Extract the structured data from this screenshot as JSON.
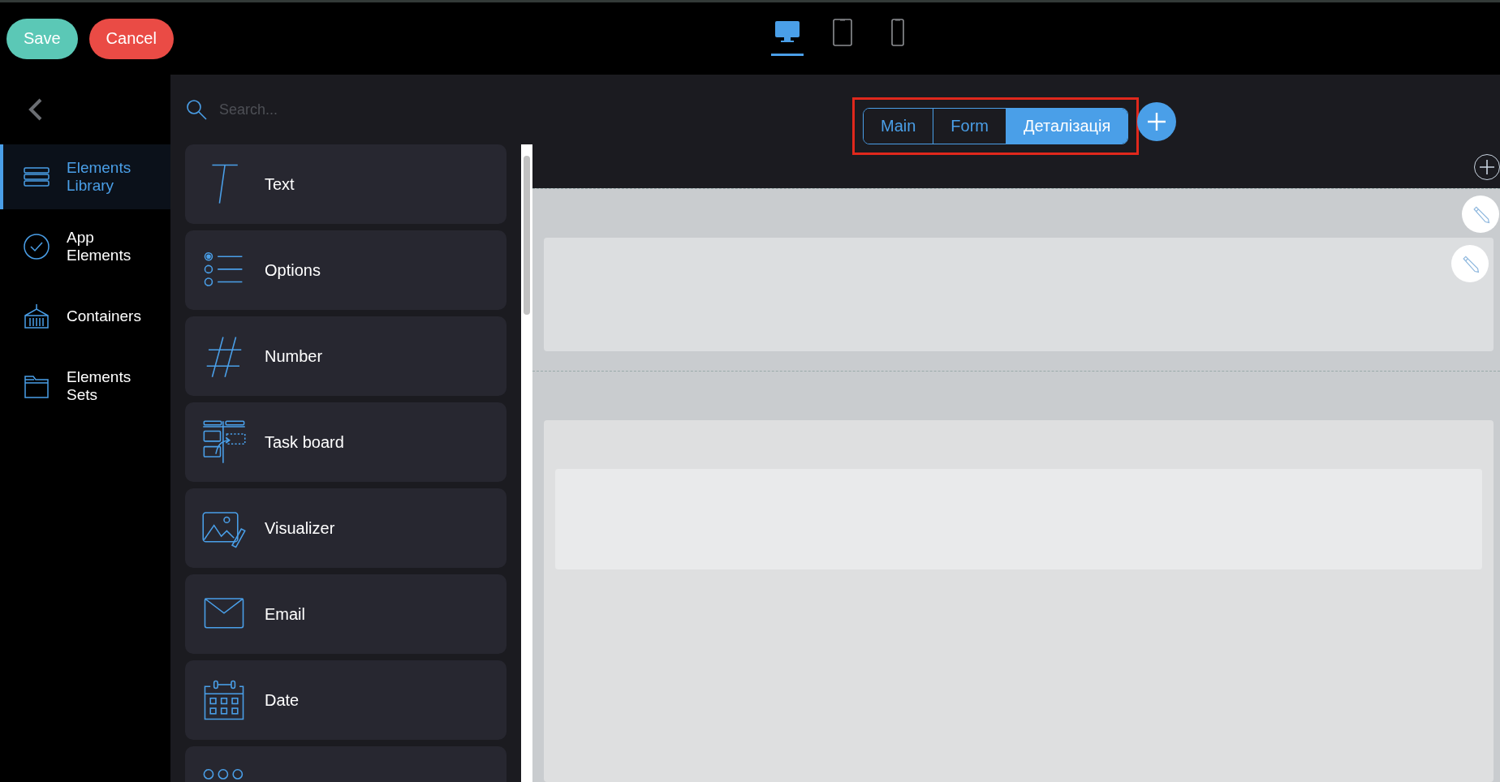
{
  "toolbar": {
    "buttons": [
      {
        "label": "Save",
        "kind": "save"
      },
      {
        "label": "Cancel",
        "kind": "cancel"
      }
    ],
    "devices": [
      {
        "kind": "desktop",
        "selected": true
      },
      {
        "kind": "tablet",
        "selected": false
      },
      {
        "kind": "phone",
        "selected": false
      }
    ]
  },
  "sidebar": {
    "items": [
      {
        "label": "Elements Library",
        "kind": "library",
        "selected": true
      },
      {
        "label": "App Elements",
        "kind": "check",
        "selected": false
      },
      {
        "label": "Containers",
        "kind": "container",
        "selected": false
      },
      {
        "label": "Elements Sets",
        "kind": "folder",
        "selected": false
      }
    ]
  },
  "library": {
    "search": {
      "placeholder": "Search..."
    },
    "items": [
      {
        "label": "Text",
        "kind": "text"
      },
      {
        "label": "Options",
        "kind": "options"
      },
      {
        "label": "Number",
        "kind": "number"
      },
      {
        "label": "Task board",
        "kind": "taskboard"
      },
      {
        "label": "Visualizer",
        "kind": "visualizer"
      },
      {
        "label": "Email",
        "kind": "email"
      },
      {
        "label": "Date",
        "kind": "date"
      },
      {
        "kind": "radio"
      }
    ]
  },
  "canvas": {
    "tabs": [
      {
        "label": "Main",
        "selected": false
      },
      {
        "label": "Form",
        "selected": false
      },
      {
        "label": "Деталізація",
        "selected": true
      }
    ]
  }
}
